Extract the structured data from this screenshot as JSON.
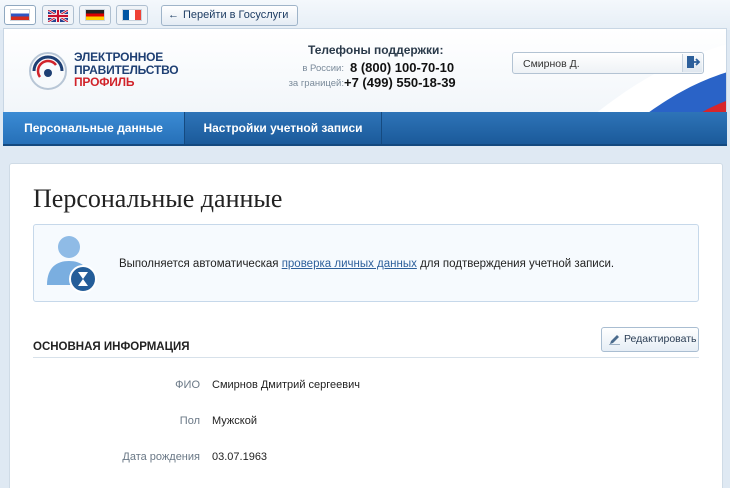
{
  "languages": [
    {
      "code": "ru",
      "active": true
    },
    {
      "code": "en",
      "active": false
    },
    {
      "code": "de",
      "active": false
    },
    {
      "code": "fr",
      "active": false
    }
  ],
  "gosuslugi_button": {
    "arrow": "←",
    "label": "Перейти в Госуслуги"
  },
  "logo": {
    "line1": "ЭЛЕКТРОННОЕ",
    "line2": "ПРАВИТЕЛЬСТВО",
    "line3": "ПРОФИЛЬ"
  },
  "support": {
    "title": "Телефоны поддержки:",
    "russia_label": "в России:",
    "russia_phone": "8 (800) 100-70-10",
    "abroad_label": "за границей:",
    "abroad_phone": "+7 (499) 550-18-39"
  },
  "user": {
    "name": "Смирнов Д.",
    "logout_icon": "exit-icon"
  },
  "nav": {
    "tabs": [
      {
        "label": "Персональные данные",
        "active": true
      },
      {
        "label": "Настройки учетной записи",
        "active": false
      }
    ]
  },
  "main": {
    "title": "Персональные данные",
    "notice": {
      "before": "Выполняется автоматическая ",
      "link": "проверка личных данных",
      "after": " для подтверждения учетной записи."
    },
    "section_title": "ОСНОВНАЯ ИНФОРМАЦИЯ",
    "edit_label": "Редактировать",
    "fields": [
      {
        "label": "ФИО",
        "value": "Смирнов Дмитрий сергеевич"
      },
      {
        "label": "Пол",
        "value": "Мужской"
      },
      {
        "label": "Дата рождения",
        "value": "03.07.1963"
      }
    ]
  },
  "colors": {
    "nav": "#1b5a9a",
    "brand_blue": "#1e3f73",
    "brand_red": "#d1232a",
    "link": "#2c5f9b"
  }
}
